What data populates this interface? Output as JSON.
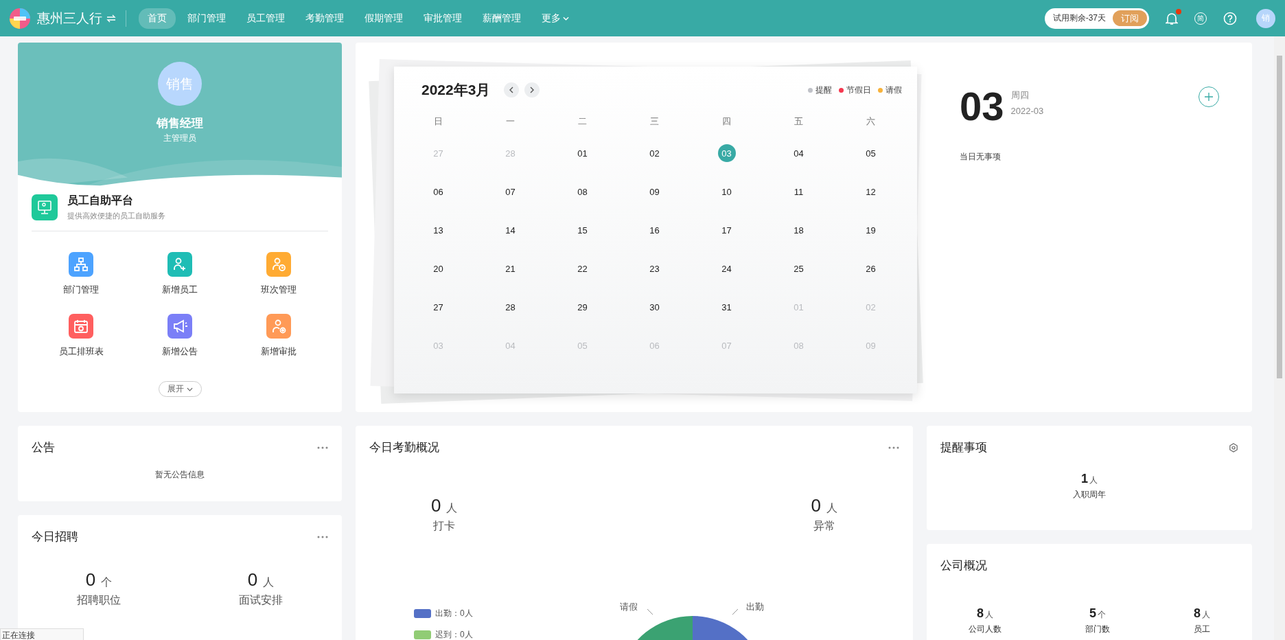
{
  "topbar": {
    "brand": "惠州三人行",
    "nav": [
      {
        "label": "首页",
        "selected": true
      },
      {
        "label": "部门管理",
        "selected": false
      },
      {
        "label": "员工管理",
        "selected": false
      },
      {
        "label": "考勤管理",
        "selected": false
      },
      {
        "label": "假期管理",
        "selected": false
      },
      {
        "label": "审批管理",
        "selected": false
      },
      {
        "label": "薪酬管理",
        "selected": false
      },
      {
        "label": "更多",
        "selected": false
      }
    ],
    "trial": "试用剩余-37天",
    "subscribe": "订阅",
    "notification_dot": true,
    "lang": "简",
    "avatar": "销"
  },
  "profile": {
    "avatar": "销售",
    "name": "销售经理",
    "role": "主管理员"
  },
  "self_service": {
    "title": "员工自助平台",
    "subtitle": "提供高效便捷的员工自助服务",
    "apps": [
      {
        "label": "部门管理",
        "kind": "org",
        "color": "#4da3ff"
      },
      {
        "label": "新增员工",
        "kind": "adduser",
        "color": "#1fbdb5"
      },
      {
        "label": "班次管理",
        "kind": "shift",
        "color": "#ffab33"
      },
      {
        "label": "员工排班表",
        "kind": "calendar",
        "color": "#ff5f5f"
      },
      {
        "label": "新增公告",
        "kind": "megaphone",
        "color": "#7b7ff7"
      },
      {
        "label": "新增审批",
        "kind": "approve",
        "color": "#ff9a57"
      }
    ],
    "expand": "展开"
  },
  "calendar": {
    "title": "2022年3月",
    "legend": [
      {
        "label": "提醒",
        "color": "#c0c2c8"
      },
      {
        "label": "节假日",
        "color": "#f5384f"
      },
      {
        "label": "请假",
        "color": "#f7b23b"
      }
    ],
    "weekdays": [
      "日",
      "一",
      "二",
      "三",
      "四",
      "五",
      "六"
    ],
    "weeks": [
      [
        {
          "day": "27",
          "muted": true,
          "selected": false
        },
        {
          "day": "28",
          "muted": true,
          "selected": false
        },
        {
          "day": "01",
          "muted": false,
          "selected": false
        },
        {
          "day": "02",
          "muted": false,
          "selected": false
        },
        {
          "day": "03",
          "muted": false,
          "selected": true
        },
        {
          "day": "04",
          "muted": false,
          "selected": false
        },
        {
          "day": "05",
          "muted": false,
          "selected": false
        }
      ],
      [
        {
          "day": "06",
          "muted": false,
          "selected": false
        },
        {
          "day": "07",
          "muted": false,
          "selected": false
        },
        {
          "day": "08",
          "muted": false,
          "selected": false
        },
        {
          "day": "09",
          "muted": false,
          "selected": false
        },
        {
          "day": "10",
          "muted": false,
          "selected": false
        },
        {
          "day": "11",
          "muted": false,
          "selected": false
        },
        {
          "day": "12",
          "muted": false,
          "selected": false
        }
      ],
      [
        {
          "day": "13",
          "muted": false,
          "selected": false
        },
        {
          "day": "14",
          "muted": false,
          "selected": false
        },
        {
          "day": "15",
          "muted": false,
          "selected": false
        },
        {
          "day": "16",
          "muted": false,
          "selected": false
        },
        {
          "day": "17",
          "muted": false,
          "selected": false
        },
        {
          "day": "18",
          "muted": false,
          "selected": false
        },
        {
          "day": "19",
          "muted": false,
          "selected": false
        }
      ],
      [
        {
          "day": "20",
          "muted": false,
          "selected": false
        },
        {
          "day": "21",
          "muted": false,
          "selected": false
        },
        {
          "day": "22",
          "muted": false,
          "selected": false
        },
        {
          "day": "23",
          "muted": false,
          "selected": false
        },
        {
          "day": "24",
          "muted": false,
          "selected": false
        },
        {
          "day": "25",
          "muted": false,
          "selected": false
        },
        {
          "day": "26",
          "muted": false,
          "selected": false
        }
      ],
      [
        {
          "day": "27",
          "muted": false,
          "selected": false
        },
        {
          "day": "28",
          "muted": false,
          "selected": false
        },
        {
          "day": "29",
          "muted": false,
          "selected": false
        },
        {
          "day": "30",
          "muted": false,
          "selected": false
        },
        {
          "day": "31",
          "muted": false,
          "selected": false
        },
        {
          "day": "01",
          "muted": true,
          "selected": false
        },
        {
          "day": "02",
          "muted": true,
          "selected": false
        }
      ],
      [
        {
          "day": "03",
          "muted": true,
          "selected": false
        },
        {
          "day": "04",
          "muted": true,
          "selected": false
        },
        {
          "day": "05",
          "muted": true,
          "selected": false
        },
        {
          "day": "06",
          "muted": true,
          "selected": false
        },
        {
          "day": "07",
          "muted": true,
          "selected": false
        },
        {
          "day": "08",
          "muted": true,
          "selected": false
        },
        {
          "day": "09",
          "muted": true,
          "selected": false
        }
      ]
    ]
  },
  "day_panel": {
    "day": "03",
    "weekday": "周四",
    "month": "2022-03",
    "empty": "当日无事项"
  },
  "announcement": {
    "title": "公告",
    "empty": "暂无公告信息"
  },
  "recruit": {
    "title": "今日招聘",
    "stats": [
      {
        "value": "0",
        "unit": "个",
        "label": "招聘职位"
      },
      {
        "value": "0",
        "unit": "人",
        "label": "面试安排"
      }
    ]
  },
  "attendance": {
    "title": "今日考勤概况",
    "stats": [
      {
        "value": "0",
        "unit": "人",
        "label": "打卡"
      },
      {
        "value": "0",
        "unit": "人",
        "label": "异常"
      }
    ],
    "legend": [
      {
        "label": "出勤：0人",
        "color": "#5470c6"
      },
      {
        "label": "迟到：0人",
        "color": "#91cc75"
      }
    ],
    "donut_labels": [
      "请假",
      "出勤"
    ]
  },
  "reminders": {
    "title": "提醒事项",
    "stats": [
      {
        "value": "1",
        "unit": "人",
        "label": "入职周年"
      }
    ]
  },
  "company": {
    "title": "公司概况",
    "stats": [
      {
        "value": "8",
        "unit": "人",
        "label": "公司人数"
      },
      {
        "value": "5",
        "unit": "个",
        "label": "部门数"
      },
      {
        "value": "8",
        "unit": "人",
        "label": "员工"
      }
    ]
  },
  "status_text": "正在连接"
}
